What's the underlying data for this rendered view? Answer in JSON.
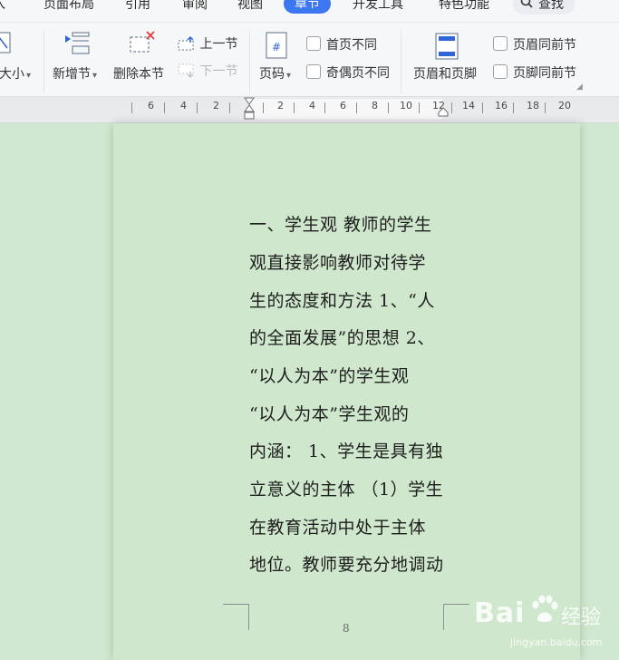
{
  "tabs": [
    "入",
    "页面布局",
    "引用",
    "审阅",
    "视图",
    "章节",
    "开发工具",
    "特色功能"
  ],
  "active_tab": "章节",
  "search": {
    "label": "查找",
    "icon": "search-icon"
  },
  "toolbar": {
    "size_label": "大小",
    "new_section": "新增节",
    "delete_section": "删除本节",
    "prev_section": "上一节",
    "next_section": "下一节",
    "page_number": "页码",
    "first_page_diff": "首页不同",
    "odd_even_diff": "奇偶页不同",
    "header_footer": "页眉和页脚",
    "header_same_prev": "页眉同前节",
    "footer_same_prev": "页脚同前节"
  },
  "ruler": {
    "labels": [
      "6",
      "4",
      "2",
      "2",
      "4",
      "6",
      "8",
      "10",
      "12",
      "14",
      "16",
      "18",
      "20"
    ]
  },
  "document": {
    "lines": [
      "一、学生观 教师的学生",
      "观直接影响教师对待学",
      "生的态度和方法 1、“人",
      "的全面发展”的思想 2、",
      "“以人为本”的学生观",
      "“以人为本”学生观的",
      "内涵： 1、学生是具有独",
      "立意义的主体 （1）学生",
      "在教育活动中处于主体",
      "地位。教师要充分地调动"
    ],
    "page_number": "8"
  },
  "watermark": {
    "brand": "Bai",
    "suffix": "经验",
    "url": "jingyan.baidu.com"
  },
  "colors": {
    "accent": "#3c76f1",
    "page_bg": "#cfe7cc",
    "workspace_bg": "#cfe8cf",
    "toolbar_bg": "#f6f7f9"
  }
}
